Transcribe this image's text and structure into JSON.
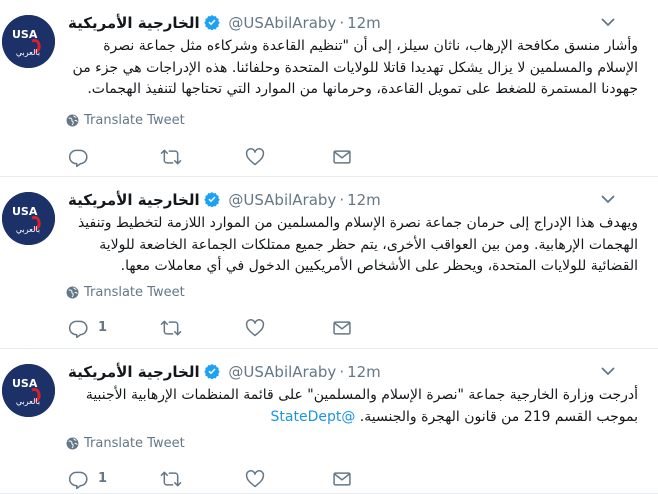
{
  "tweets": [
    {
      "name": "الخارجية الأمريكية",
      "handle": "@USAbilAraby",
      "separator": "·",
      "time": "12m",
      "text": "وأشار منسق مكافحة الإرهاب، ناثان سيلز، إلى أن \"تنظيم القاعدة وشركاءه مثل جماعة نصرة الإسلام والمسلمين لا يزال يشكل تهديدا قاتلا للولايات المتحدة وحلفائنا. هذه الإدراجات هي جزء من جهودنا المستمرة للضغط على تمويل القاعدة، وحرمانها من الموارد التي تحتاجها لتنفيذ الهجمات.",
      "mention": "",
      "translate_label": "Translate Tweet",
      "reply_count": "",
      "retweet_count": "",
      "like_count": ""
    },
    {
      "name": "الخارجية الأمريكية",
      "handle": "@USAbilAraby",
      "separator": "·",
      "time": "12m",
      "text": "ويهدف هذا الإدراج إلى حرمان جماعة نصرة الإسلام والمسلمين من الموارد اللازمة لتخطيط وتنفيذ الهجمات الإرهابية. ومن بين العواقب الأخرى، يتم حظر جميع ممتلكات الجماعة الخاضعة للولاية القضائية للولايات المتحدة، ويحظر على الأشخاص الأمريكيين الدخول في أي معاملات معها.",
      "mention": "",
      "translate_label": "Translate Tweet",
      "reply_count": "1",
      "retweet_count": "",
      "like_count": ""
    },
    {
      "name": "الخارجية الأمريكية",
      "handle": "@USAbilAraby",
      "separator": "·",
      "time": "12m",
      "text": "أدرجت وزارة الخارجية جماعة \"نصرة الإسلام والمسلمين\" على قائمة المنظمات الإرهابية الأجنبية بموجب القسم 219 من قانون الهجرة والجنسية. ",
      "mention": "@StateDept",
      "translate_label": "Translate Tweet",
      "reply_count": "1",
      "retweet_count": "",
      "like_count": ""
    }
  ],
  "avatar": {
    "top_text": "USA",
    "bottom_text": "بالعربي",
    "background": "#1b3168",
    "accent": "#d6202a"
  },
  "colors": {
    "text": "#14171a",
    "muted": "#657786",
    "link": "#1b95e0",
    "border": "#e6ecf0",
    "verified": "#1da1f2"
  },
  "icons": [
    "chevron-down-icon",
    "verified-badge-icon",
    "globe-icon",
    "reply-icon",
    "retweet-icon",
    "like-icon",
    "direct-message-icon"
  ]
}
